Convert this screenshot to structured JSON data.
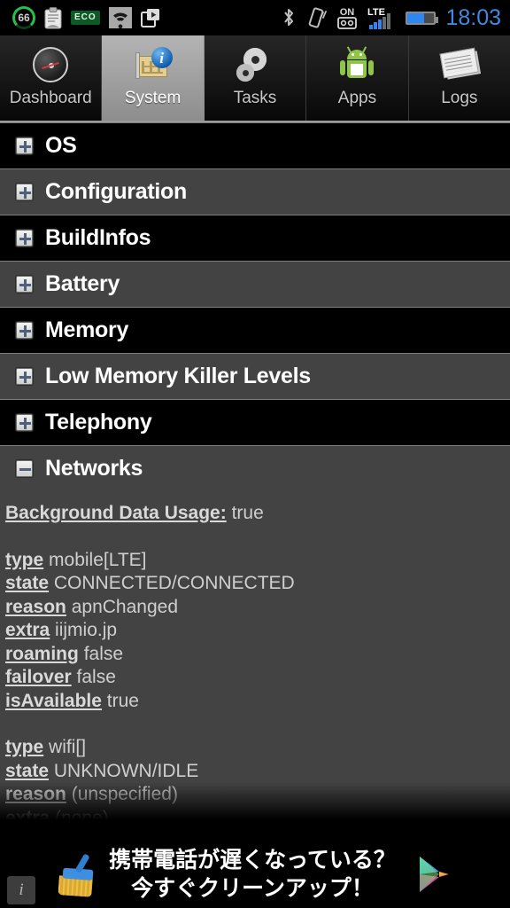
{
  "statusbar": {
    "left_icons": [
      {
        "name": "battery-percent-circle-icon",
        "value": "66"
      },
      {
        "name": "clipboard-note-icon",
        "value": ""
      },
      {
        "name": "eco-mode-icon",
        "value": "ECO"
      },
      {
        "name": "wifi-icon",
        "value": ""
      },
      {
        "name": "play-store-download-icon",
        "value": ""
      }
    ],
    "right_icons": [
      {
        "name": "bluetooth-icon"
      },
      {
        "name": "vibrate-mode-icon"
      },
      {
        "name": "voicemail-on-icon"
      },
      {
        "name": "lte-signal-icon"
      },
      {
        "name": "battery-icon"
      }
    ],
    "lte_label": "LTE",
    "voicemail_label": "ON",
    "clock": "18:03"
  },
  "tabs": [
    {
      "label": "Dashboard",
      "icon": "gauge-icon",
      "selected": false
    },
    {
      "label": "System",
      "icon": "system-info-icon",
      "selected": true
    },
    {
      "label": "Tasks",
      "icon": "gears-icon",
      "selected": false
    },
    {
      "label": "Apps",
      "icon": "android-robot-icon",
      "selected": false
    },
    {
      "label": "Logs",
      "icon": "newspaper-icon",
      "selected": false
    }
  ],
  "sections": [
    {
      "label": "OS",
      "expanded": false
    },
    {
      "label": "Configuration",
      "expanded": false
    },
    {
      "label": "BuildInfos",
      "expanded": false
    },
    {
      "label": "Battery",
      "expanded": false
    },
    {
      "label": "Memory",
      "expanded": false
    },
    {
      "label": "Low Memory Killer Levels",
      "expanded": false
    },
    {
      "label": "Telephony",
      "expanded": false
    },
    {
      "label": "Networks",
      "expanded": true
    }
  ],
  "detail": {
    "background_data_usage": {
      "key": "Background Data Usage:",
      "value": "true"
    },
    "networks": [
      {
        "rows": [
          {
            "key": "type",
            "value": "mobile[LTE]"
          },
          {
            "key": "state",
            "value": "CONNECTED/CONNECTED"
          },
          {
            "key": "reason",
            "value": "apnChanged"
          },
          {
            "key": "extra",
            "value": "iijmio.jp"
          },
          {
            "key": "roaming",
            "value": "false"
          },
          {
            "key": "failover",
            "value": "false"
          },
          {
            "key": "isAvailable",
            "value": "true"
          }
        ]
      },
      {
        "rows": [
          {
            "key": "type",
            "value": "wifi[]"
          },
          {
            "key": "state",
            "value": "UNKNOWN/IDLE"
          },
          {
            "key": "reason",
            "value": "(unspecified)"
          },
          {
            "key": "extra",
            "value": "(none)"
          }
        ]
      }
    ]
  },
  "ad": {
    "info_badge": "i",
    "broom_icon": "broom-icon",
    "line1": "携帯電話が遅くなっている？",
    "line2": "今すぐクリーンアップ！",
    "store_icon": "google-play-icon"
  },
  "colors": {
    "row_dark": "#000000",
    "row_light": "#434343",
    "accent_blue": "#3f8ae0",
    "eco_green": "#0d5a26"
  }
}
